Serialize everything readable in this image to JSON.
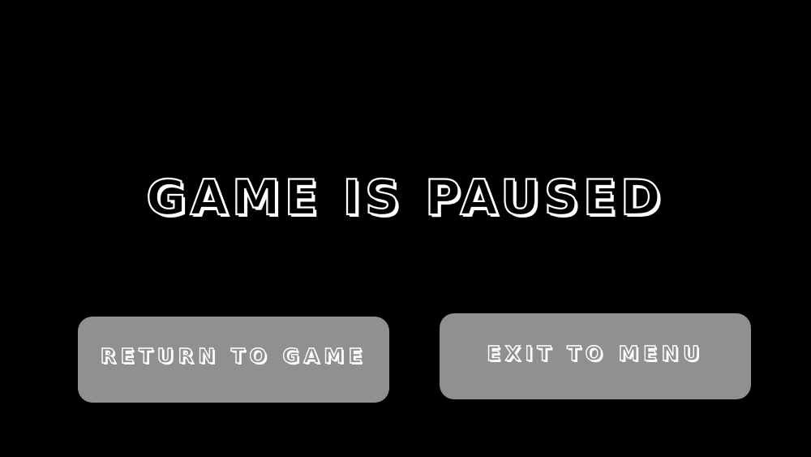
{
  "screen": {
    "background_color": "#000000"
  },
  "pause_menu": {
    "title": "GAME IS PAUSED",
    "buttons": [
      {
        "label": "RETURN TO GAME",
        "color": "#909093"
      },
      {
        "label": "EXIT TO MENU",
        "color": "#909093"
      }
    ]
  }
}
